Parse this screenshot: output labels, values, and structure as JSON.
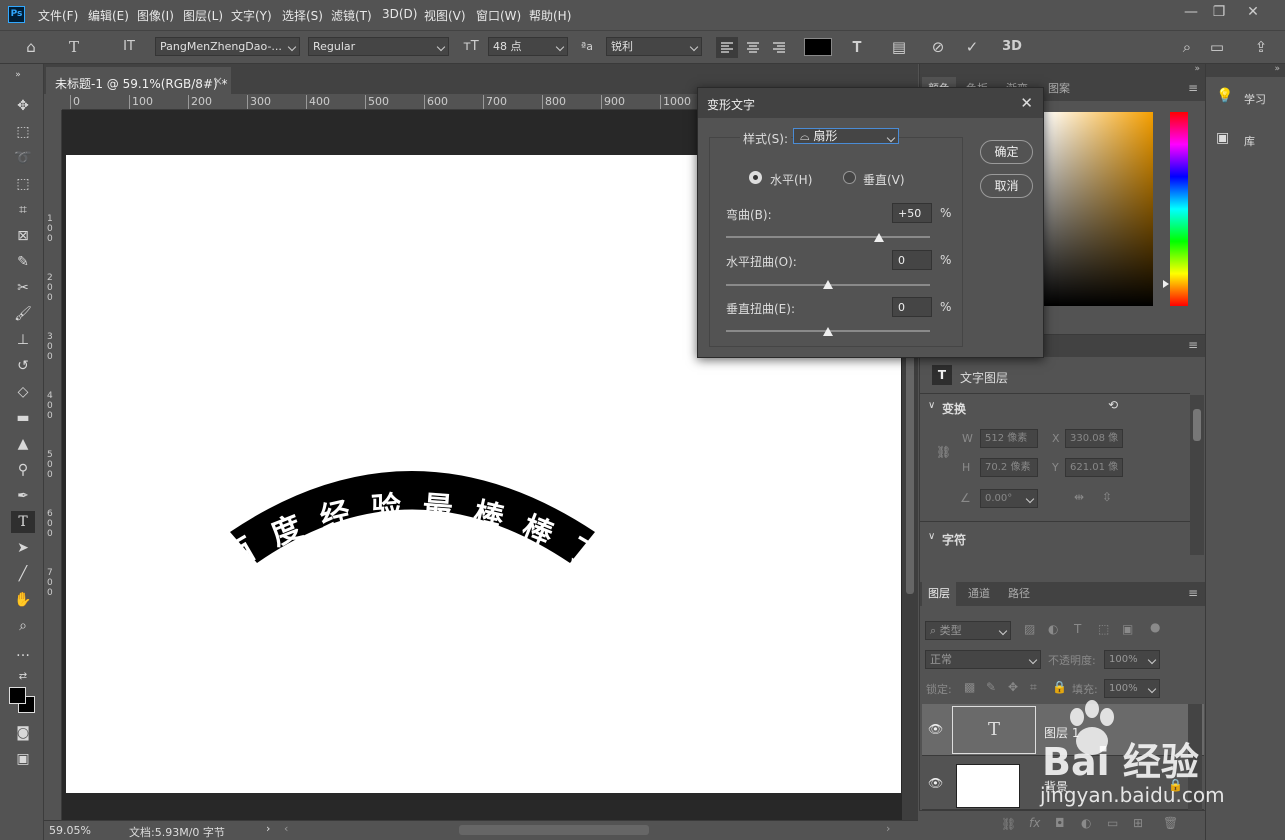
{
  "app": {
    "logo": "Ps"
  },
  "menu": [
    "文件(F)",
    "编辑(E)",
    "图像(I)",
    "图层(L)",
    "文字(Y)",
    "选择(S)",
    "滤镜(T)",
    "3D(D)",
    "视图(V)",
    "窗口(W)",
    "帮助(H)"
  ],
  "window_controls": {
    "minimize": "—",
    "restore": "❐",
    "close": "✕"
  },
  "options": {
    "font_family": "PangMenZhengDao-...",
    "font_style": "Regular",
    "font_size": "48 点",
    "aa_label": "ªa",
    "anti_alias": "锐利",
    "text_color": "#000000",
    "three_d": "3D"
  },
  "document_tab": {
    "title": "未标题-1 @ 59.1%(RGB/8#) *",
    "close": "×"
  },
  "ruler": {
    "top": [
      "0",
      "100",
      "200",
      "300",
      "400",
      "500",
      "600",
      "700",
      "800",
      "900",
      "1000"
    ],
    "left": [
      "1\n0\n0",
      "2\n0\n0",
      "3\n0\n0",
      "4\n0\n0",
      "5\n0\n0",
      "6\n0\n0",
      "7\n0\n0"
    ]
  },
  "canvas_text": [
    "百",
    "度",
    "经",
    "验",
    "最",
    "棒",
    "棒",
    "了"
  ],
  "status": {
    "zoom": "59.05%",
    "doc_info": "文档:5.93M/0 字节"
  },
  "warp_dialog": {
    "title": "变形文字",
    "style_label": "样式(S):",
    "style_value": "扇形",
    "horizontal": "水平(H)",
    "vertical": "垂直(V)",
    "bend_label": "弯曲(B):",
    "bend_value": "+50",
    "hdist_label": "水平扭曲(O):",
    "hdist_value": "0",
    "vdist_label": "垂直扭曲(E):",
    "vdist_value": "0",
    "percent": "%",
    "ok": "确定",
    "cancel": "取消",
    "bend_level": 0.75,
    "hdist_level": 0.5,
    "vdist_level": 0.5
  },
  "color_panel": {
    "tabs": [
      "颜色",
      "色板",
      "渐变",
      "图案"
    ]
  },
  "properties": {
    "layer_type": "文字图层",
    "transform": "变换",
    "w_label": "W",
    "w_value": "512 像素",
    "x_label": "X",
    "x_value": "330.08 像",
    "h_label": "H",
    "h_value": "70.2 像素",
    "y_label": "Y",
    "y_value": "621.01 像",
    "angle_value": "0.00°",
    "character": "字符"
  },
  "layers_panel": {
    "tabs": [
      "图层",
      "通道",
      "路径"
    ],
    "filter": "类型",
    "blend": "正常",
    "opacity_label": "不透明度:",
    "opacity_value": "100%",
    "lock_label": "锁定:",
    "fill_label": "填充:",
    "fill_value": "100%",
    "layers": [
      {
        "name": "图层 1"
      },
      {
        "name": "背景"
      }
    ]
  },
  "side_panel": {
    "learn": "学习",
    "library": "库"
  },
  "watermark": {
    "brand": "Bai 经验",
    "url": "jingyan.baidu.com"
  }
}
